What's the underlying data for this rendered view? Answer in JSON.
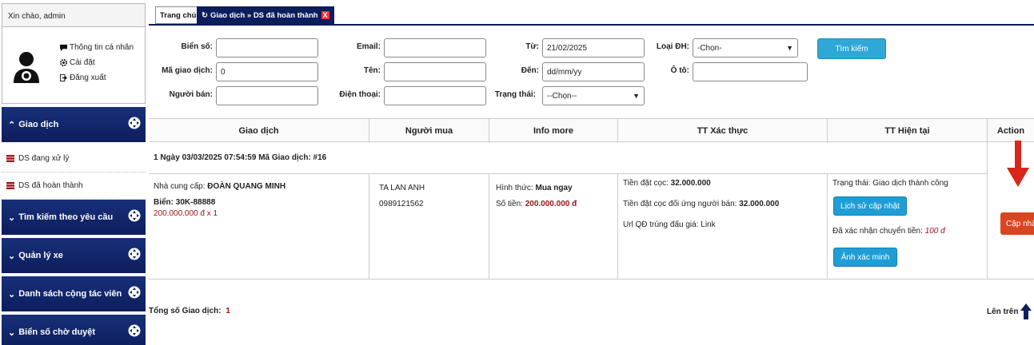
{
  "sidebar": {
    "greeting": "Xin chào, admin",
    "user_menu": [
      "Thông tin cá nhân",
      "Cài đặt",
      "Đăng xuất"
    ],
    "sections": [
      {
        "label": "Giao dịch",
        "caret": "^"
      },
      {
        "label": "Tìm kiếm theo yêu cầu",
        "caret": "v"
      },
      {
        "label": "Quản lý xe",
        "caret": "v"
      },
      {
        "label": "Danh sách cộng tác viên",
        "caret": "v"
      },
      {
        "label": "Biển số chờ duyệt",
        "caret": "v"
      }
    ],
    "items": [
      "DS đang xử lý",
      "DS đã hoàn thành"
    ]
  },
  "tabs": {
    "home": "Trang chủ",
    "active": "Giao dịch » DS đã hoàn thành",
    "close": "X"
  },
  "form": {
    "labels": {
      "bien_so": "Biển số:",
      "ma_gd": "Mã giao dịch:",
      "nguoi_ban": "Người bán:",
      "email": "Email:",
      "ten": "Tên:",
      "dien_thoai": "Điện thoại:",
      "tu": "Từ:",
      "den": "Đến:",
      "trang_thai": "Trạng thái:",
      "loai_dh": "Loại ĐH:",
      "o_to": "Ô tô:"
    },
    "values": {
      "bien_so": "",
      "ma_gd": "0",
      "nguoi_ban": "",
      "email": "",
      "ten": "",
      "dien_thoai": "",
      "tu": "21/02/2025",
      "den": "dd/mm/yy",
      "trang_thai": "--Chọn--",
      "loai_dh": "-Chọn-",
      "o_to": ""
    },
    "search_button": "Tìm kiếm"
  },
  "table": {
    "headers": [
      "Giao dịch",
      "Người mua",
      "Info more",
      "TT Xác thực",
      "TT Hiện tại",
      "Action"
    ],
    "group_row": "1   Ngày 03/03/2025 07:54:59   Mã Giao dịch: #16",
    "row": {
      "supplier_label": "Nhà cung cấp: ",
      "supplier": "ĐOÀN QUANG MINH",
      "plate": "Biển: 30K-88888",
      "price_line": "200.000.000 đ x 1",
      "buyer_name": "TA LAN ANH",
      "buyer_phone": "0989121562",
      "form_label": "Hình thức: ",
      "form_value": "Mua ngay",
      "amount_label": "Số tiền: ",
      "amount_value": "200.000.000 đ",
      "deposit_label": "Tiền đặt cọc: ",
      "deposit_value": "32.000.000",
      "deposit2_label": "Tiền đặt cọc đối ứng người bán: ",
      "deposit2_value": "32.000.000",
      "url_line": "Url QĐ trúng đấu giá: Link",
      "status_line": "Trạng thái: Giao dịch thành công",
      "history_button": "Lịch sử cập nhật",
      "confirm_label": "Đã xác nhận chuyển tiền: ",
      "confirm_value": "100 đ",
      "photo_button": "Ảnh xác minh",
      "update_button": "Cập nhật"
    },
    "total_label": "Tổng số Giao dịch:",
    "total_value": "1",
    "to_top": "Lên trên"
  },
  "colors": {
    "nav_dark": "#0d1d5c",
    "search_blue": "#2fa8d8",
    "update_orange": "#d9451f",
    "price_red": "#a0141a",
    "arrow_red": "#d8261a"
  }
}
